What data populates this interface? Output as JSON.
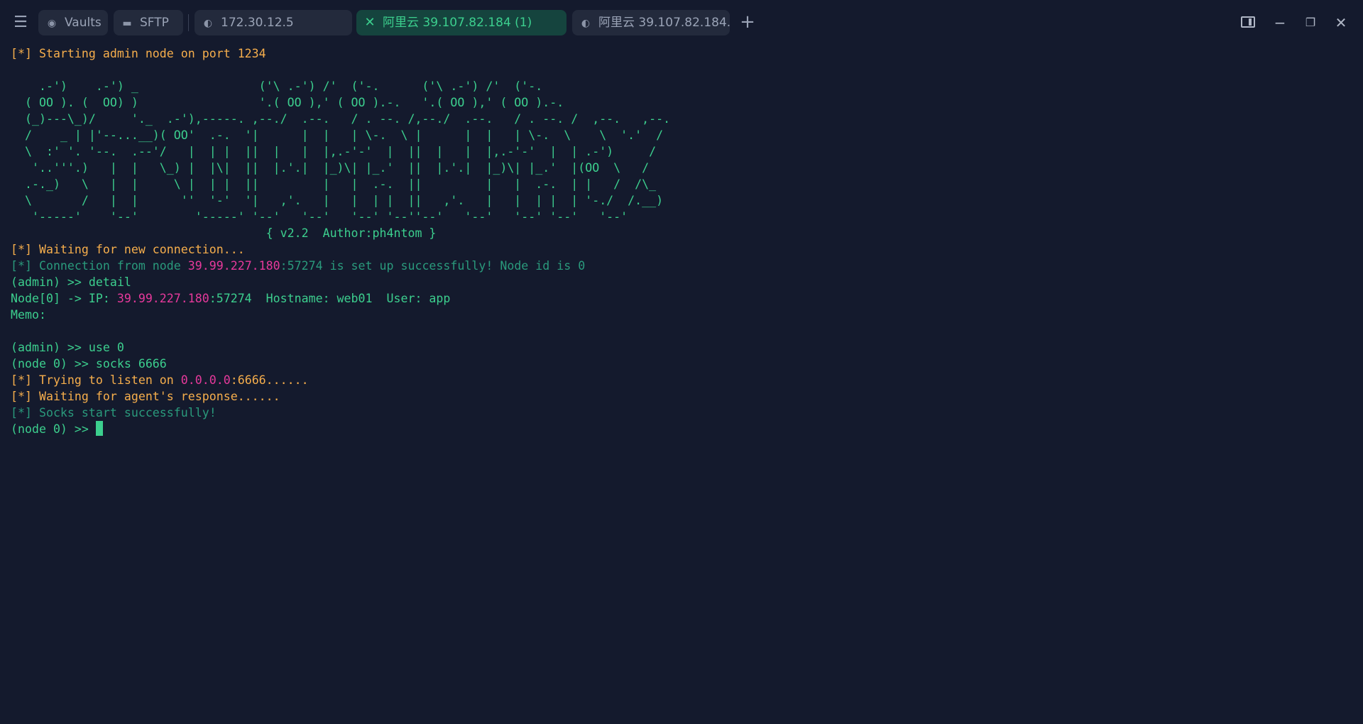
{
  "titlebar": {
    "menu_icon": "hamburger-menu-icon",
    "tabs": [
      {
        "label": "Vaults",
        "icon": "vault-icon"
      },
      {
        "label": "SFTP",
        "icon": "folder-icon"
      },
      {
        "label": "172.30.12.5",
        "icon": "linux-icon"
      },
      {
        "label": "阿里云 39.107.82.184 (1)",
        "icon": "close-icon",
        "active": true
      },
      {
        "label": "阿里云 39.107.82.184...",
        "icon": "linux-icon"
      }
    ],
    "new_tab_glyph": "+",
    "window_controls": [
      "split-view-icon",
      "minimize-icon",
      "restore-icon",
      "close-icon"
    ]
  },
  "colors": {
    "background": "#141a2d",
    "terminal_green": "#3ccf8e",
    "terminal_dim": "#2a9a7c",
    "warning_orange": "#f6ae4c",
    "ip_magenta": "#e6399b",
    "active_tab_bg": "#15443e"
  },
  "terminal": {
    "line_starting": "[*] Starting admin node on port 1234",
    "banner": [
      "    .-')    .-') _                 ('\\ .-') /'  ('-.      ('\\ .-') /'  ('-.",
      "  ( OO ). (  OO) )                 '.( OO ),' ( OO ).-.   '.( OO ),' ( OO ).-.",
      "  (_)---\\_)/     '._  .-'),-----. ,--./  .--.   / . --. /,--./  .--.   / . --. /  ,--.   ,--.",
      "  /    _ | |'--...__)( OO'  .-.  '|      |  |   | \\-.  \\ |      |  |   | \\-.  \\    \\  '.'  /",
      "  \\  :' '. '--.  .--'/   |  | |  ||  |   |  |,.-'-'  |  ||  |   |  |,.-'-'  |  | .-')     /",
      "   '..'''.)   |  |   \\_) |  |\\|  ||  |.'.|  |_)\\| |_.'  ||  |.'.|  |_)\\| |_.'  |(OO  \\   /",
      "  .-._)   \\   |  |     \\ |  | |  ||         |   |  .-.  ||         |   |  .-.  | |   /  /\\_",
      "  \\       /   |  |      ''  '-'  '|   ,'.   |   |  | |  ||   ,'.   |   |  | |  | '-./  /.__)",
      "   '-----'    '--'        '-----' '--'   '--'   '--' '--''--'   '--'   '--' '--'   '--'",
      "                                    { v2.2  Author:ph4ntom }"
    ],
    "line_waiting": "[*] Waiting for new connection...",
    "conn": {
      "prefix": "[*] Connection from node ",
      "ip": "39.99.227.180",
      "suffix": ":57274 is set up successfully! Node id is 0"
    },
    "cmd_detail": "(admin) >> detail",
    "node_line": {
      "prefix": "Node[0] -> IP: ",
      "ip": "39.99.227.180",
      "suffix": ":57274  Hostname: web01  User: app"
    },
    "memo": "Memo:",
    "cmd_use": "(admin) >> use 0",
    "cmd_socks": "(node 0) >> socks 6666",
    "listen": {
      "prefix": "[*] Trying to listen on ",
      "ip": "0.0.0.0",
      "suffix": ":6666......"
    },
    "line_wait_agent": "[*] Waiting for agent's response......",
    "line_socks_ok": "[*] Socks start successfully!",
    "prompt": "(node 0) >> "
  }
}
